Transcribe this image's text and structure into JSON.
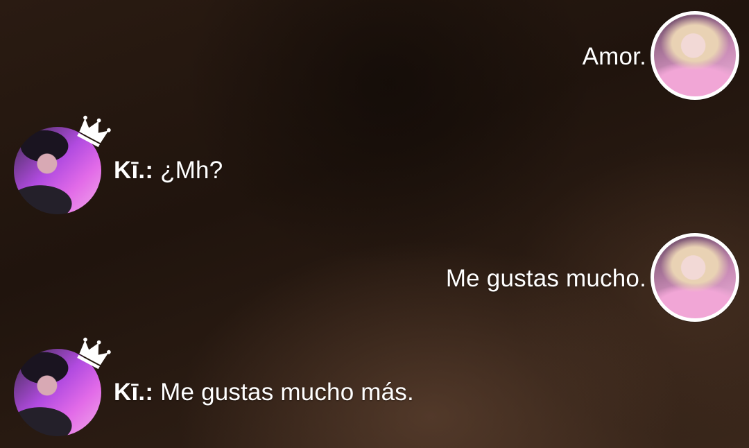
{
  "messages": [
    {
      "side": "me",
      "text": "Amor."
    },
    {
      "side": "other",
      "sender": "Kī.:",
      "text": "¿Mh?"
    },
    {
      "side": "me",
      "text": "Me gustas mucho."
    },
    {
      "side": "other",
      "sender": "Kī.:",
      "text": "Me gustas mucho más."
    }
  ],
  "icons": {
    "crown": "crown-icon"
  },
  "colors": {
    "text": "#ffffff",
    "avatar_border": "#ffffff"
  }
}
